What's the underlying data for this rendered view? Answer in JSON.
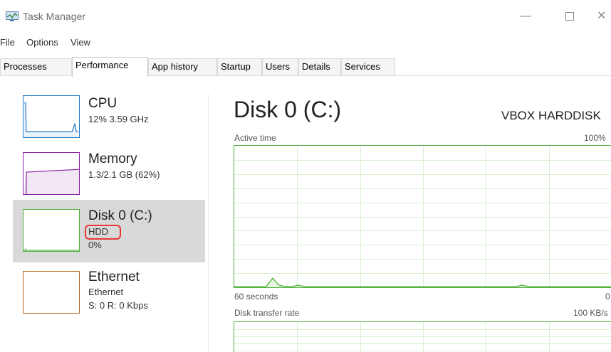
{
  "window": {
    "title": "Task Manager",
    "min_glyph": "—",
    "close_glyph": "✕"
  },
  "menu": [
    "File",
    "Options",
    "View"
  ],
  "tabs": [
    {
      "label": "Processes",
      "active": false
    },
    {
      "label": "Performance",
      "active": true
    },
    {
      "label": "App history",
      "active": false
    },
    {
      "label": "Startup",
      "active": false
    },
    {
      "label": "Users",
      "active": false
    },
    {
      "label": "Details",
      "active": false
    },
    {
      "label": "Services",
      "active": false
    }
  ],
  "sidebar": {
    "items": [
      {
        "title": "CPU",
        "sub1": "12% 3.59 GHz",
        "sub2": "",
        "color": "#1c78c8"
      },
      {
        "title": "Memory",
        "sub1": "1.3/2.1 GB (62%)",
        "sub2": "",
        "color": "#8b1ea6"
      },
      {
        "title": "Disk 0 (C:)",
        "sub1": "HDD",
        "sub2": "0%",
        "color": "#4caf3a"
      },
      {
        "title": "Ethernet",
        "sub1": "Ethernet",
        "sub2": "S: 0 R: 0 Kbps",
        "color": "#b5651d"
      }
    ]
  },
  "detail": {
    "title": "Disk 0 (C:)",
    "model": "VBOX HARDDISK",
    "active_time": {
      "label": "Active time",
      "max_label": "100%",
      "time_label": "60 seconds",
      "min_label": "0",
      "values": [
        0,
        0,
        0,
        0,
        0,
        0,
        6,
        1,
        0,
        0,
        1,
        0,
        0,
        0,
        0,
        0,
        0,
        0,
        0,
        0,
        0,
        0,
        0,
        0,
        0,
        0,
        0,
        0,
        0,
        0,
        0,
        0,
        0,
        0,
        0,
        0,
        0,
        0,
        0,
        0,
        0,
        0,
        0,
        0,
        0,
        1,
        0,
        0,
        0,
        0,
        0,
        0,
        0,
        0,
        0,
        0,
        0,
        0,
        0,
        0
      ]
    },
    "transfer_rate": {
      "label": "Disk transfer rate",
      "max_label": "100 KB/s"
    }
  },
  "colors": {
    "disk_green": "#4caf3a",
    "highlight_red": "#e53935",
    "selected_bg": "#d9d9d9"
  }
}
